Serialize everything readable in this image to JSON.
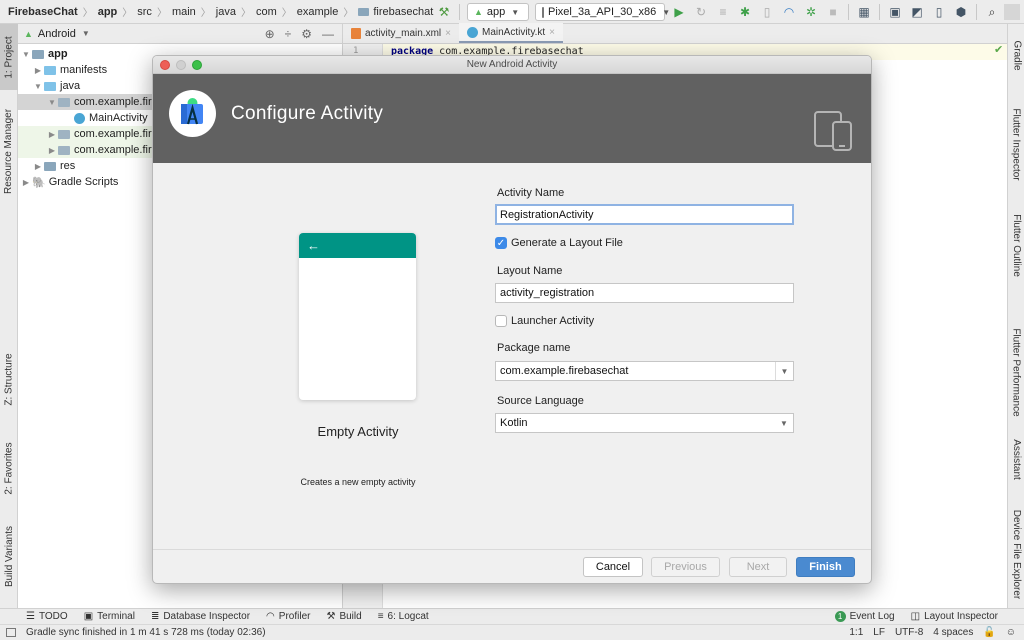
{
  "navbar": {
    "breadcrumbs": [
      "FirebaseChat",
      "app",
      "src",
      "main",
      "java",
      "com",
      "example",
      "firebasechat"
    ],
    "run_config": "app",
    "device": "Pixel_3a_API_30_x86"
  },
  "toolbar_icons": [
    "hammer-icon",
    "run-icon",
    "apply-changes-icon",
    "apply-code-changes-icon",
    "debug-icon",
    "attach-debugger-icon",
    "profile-icon",
    "debug-attach-icon",
    "stop-icon",
    "project-structure-icon",
    "terminal-icon",
    "avd-manager-icon",
    "sdk-manager-icon",
    "search-icon",
    "user-icon"
  ],
  "left_stripe": {
    "tabs": [
      "1: Project",
      "Resource Manager",
      "Z: Structure",
      "2: Favorites",
      "Build Variants"
    ]
  },
  "project_panel": {
    "view_selector": "Android",
    "tree": [
      {
        "label": "app",
        "depth": 0,
        "expanded": true,
        "bold": true,
        "type": "module"
      },
      {
        "label": "manifests",
        "depth": 1,
        "expanded": false,
        "type": "folder"
      },
      {
        "label": "java",
        "depth": 1,
        "expanded": true,
        "type": "folder"
      },
      {
        "label": "com.example.firebasechat",
        "depth": 2,
        "expanded": true,
        "type": "package",
        "selected": true
      },
      {
        "label": "MainActivity",
        "depth": 3,
        "type": "kotlin-class"
      },
      {
        "label": "com.example.firebasechat (androidTest)",
        "depth": 2,
        "expanded": false,
        "type": "package",
        "tinted": true
      },
      {
        "label": "com.example.firebasechat (test)",
        "depth": 2,
        "expanded": false,
        "type": "package",
        "tinted": true
      },
      {
        "label": "res",
        "depth": 1,
        "expanded": false,
        "type": "res-folder"
      },
      {
        "label": "Gradle Scripts",
        "depth": 0,
        "expanded": false,
        "type": "gradle"
      }
    ]
  },
  "editor": {
    "tabs": [
      {
        "label": "activity_main.xml",
        "active": false
      },
      {
        "label": "MainActivity.kt",
        "active": true
      }
    ],
    "line_number": "1",
    "code_keyword": "package",
    "code_rest": " com.example.firebasechat"
  },
  "right_stripe": {
    "tabs": [
      "Gradle",
      "Flutter Inspector",
      "Flutter Outline",
      "Flutter Performance",
      "Assistant",
      "Device File Explorer"
    ]
  },
  "dialog": {
    "window_title": "New Android Activity",
    "header_title": "Configure Activity",
    "template_name": "Empty Activity",
    "template_description": "Creates a new empty activity",
    "fields": {
      "activity_name_label": "Activity Name",
      "activity_name_value": "RegistrationActivity",
      "generate_layout_label": "Generate a Layout File",
      "generate_layout_checked": true,
      "layout_name_label": "Layout Name",
      "layout_name_value": "activity_registration",
      "launcher_activity_label": "Launcher Activity",
      "launcher_activity_checked": false,
      "package_name_label": "Package name",
      "package_name_value": "com.example.firebasechat",
      "source_language_label": "Source Language",
      "source_language_value": "Kotlin"
    },
    "buttons": {
      "cancel": "Cancel",
      "previous": "Previous",
      "next": "Next",
      "finish": "Finish"
    }
  },
  "tool_windows": {
    "left": [
      "TODO",
      "Terminal",
      "Database Inspector",
      "Profiler",
      "Build",
      "6: Logcat"
    ],
    "right": [
      {
        "label": "Event Log",
        "badge": "1"
      },
      {
        "label": "Layout Inspector"
      }
    ]
  },
  "status_bar": {
    "message": "Gradle sync finished in 1 m 41 s 728 ms (today 02:36)",
    "position": "1:1",
    "line_separator": "LF",
    "encoding": "UTF-8",
    "indent": "4 spaces"
  },
  "colors": {
    "dialog_header": "#616161",
    "preview_appbar": "#009485",
    "primary_button": "#4a8ad0",
    "checkbox_on": "#3d8ae8",
    "focus_ring": "#8fb3e3"
  }
}
